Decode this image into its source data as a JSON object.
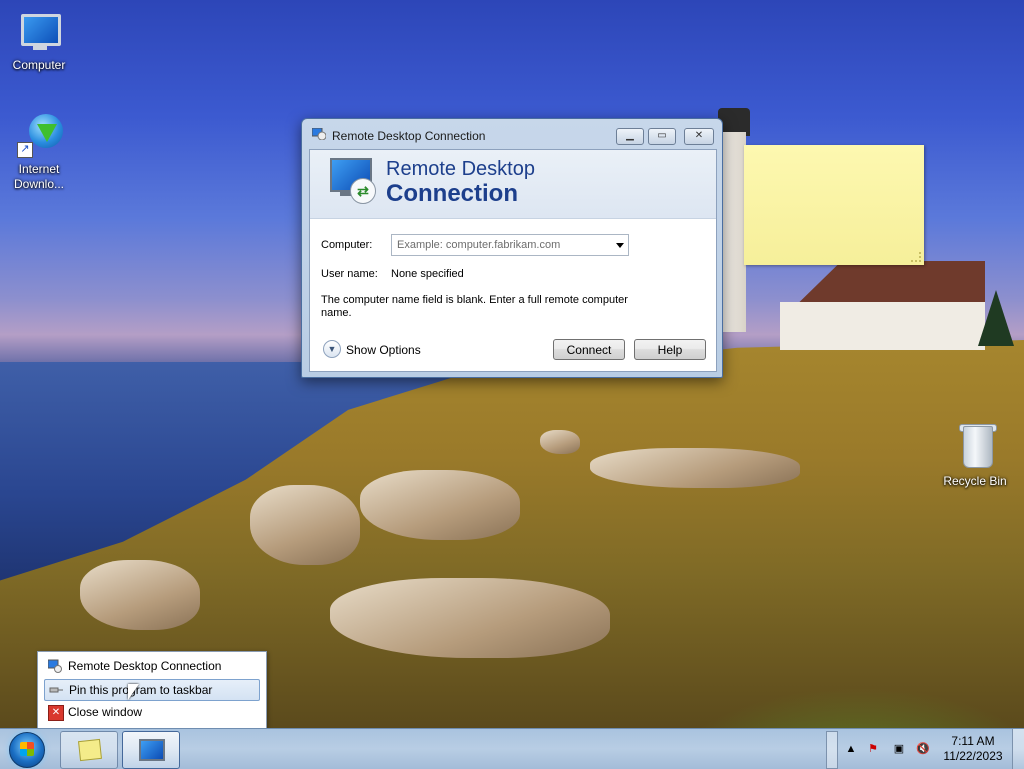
{
  "desktop": {
    "icons": [
      {
        "label": "Computer",
        "icon": "computer-icon"
      },
      {
        "label": "Internet\nDownlo...",
        "icon": "internet-download-icon"
      },
      {
        "label": "Recycle Bin",
        "icon": "recycle-bin-icon"
      }
    ]
  },
  "rdc_window": {
    "title": "Remote Desktop Connection",
    "banner_line1": "Remote Desktop",
    "banner_line2": "Connection",
    "computer_label": "Computer:",
    "computer_placeholder": "Example: computer.fabrikam.com",
    "username_label": "User name:",
    "username_value": "None specified",
    "message": "The computer name field is blank. Enter a full remote computer name.",
    "show_options": "Show Options",
    "connect_label": "Connect",
    "help_label": "Help",
    "caption_buttons": [
      "minimize",
      "maximize",
      "close"
    ]
  },
  "jump_list": {
    "items": [
      {
        "label": "Remote Desktop Connection",
        "icon": "rdc-icon"
      },
      {
        "label": "Pin this program to taskbar",
        "icon": "pin-icon",
        "highlighted": true
      },
      {
        "label": "Close window",
        "icon": "close-icon"
      }
    ]
  },
  "taskbar": {
    "start": "start-orb",
    "buttons": [
      {
        "name": "sticky-notes",
        "icon": "sticky-notes-icon"
      },
      {
        "name": "remote-desktop",
        "icon": "rdc-icon",
        "active": true
      }
    ],
    "clock_time": "7:11 AM",
    "clock_date": "11/22/2023"
  },
  "colors": {
    "accent": "#1d3f8c",
    "taskbar": "#b8cde4",
    "sticky": "#fdf8b0"
  }
}
